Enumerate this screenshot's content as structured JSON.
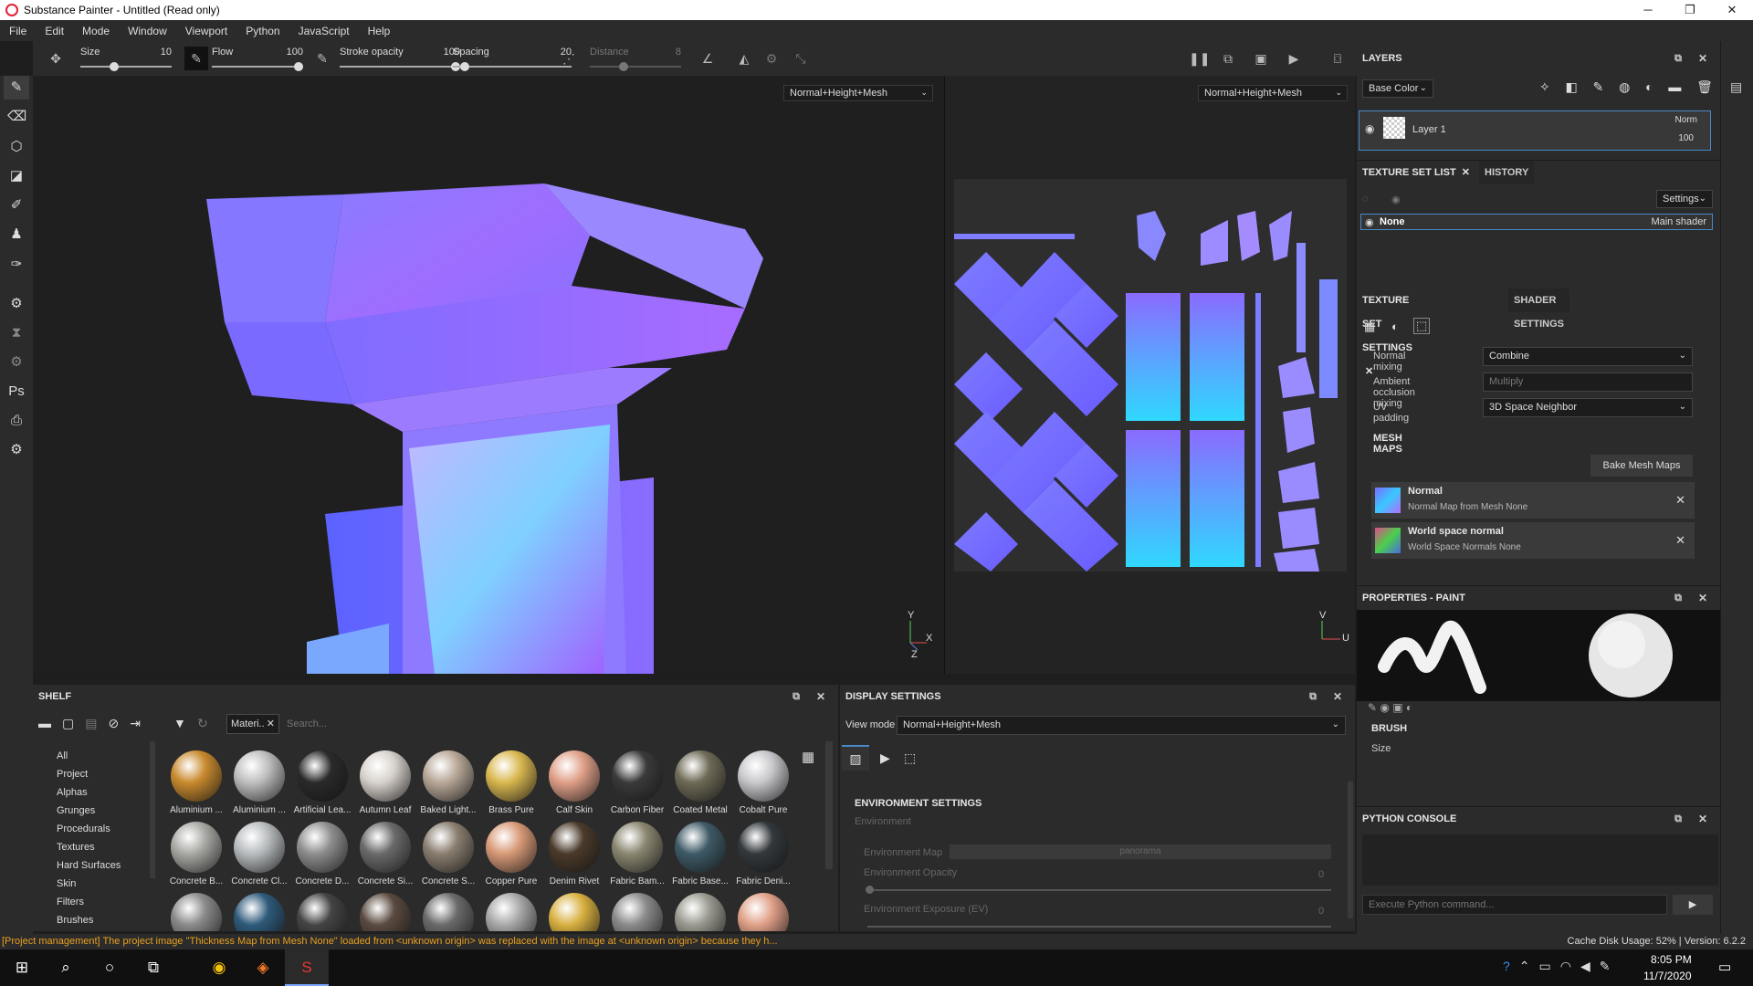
{
  "window": {
    "title": "Substance Painter - Untitled (Read only)",
    "minimize": "─",
    "restore": "❐",
    "close": "✕"
  },
  "menu": [
    "File",
    "Edit",
    "Mode",
    "Window",
    "Viewport",
    "Python",
    "JavaScript",
    "Help"
  ],
  "toolbar": {
    "size": {
      "label": "Size",
      "value": "10",
      "fraction": 0.35
    },
    "flow": {
      "label": "Flow",
      "value": "100",
      "fraction": 1.0
    },
    "stroke_opacity": {
      "label": "Stroke opacity",
      "value": "100",
      "fraction": 1.0
    },
    "spacing": {
      "label": "Spacing",
      "value": "20",
      "fraction": 0.1
    },
    "distance": {
      "label": "Distance",
      "value": "8",
      "fraction": 0.35
    }
  },
  "viewport3d": {
    "mode": "Normal+Height+Mesh",
    "axes": {
      "y": "Y",
      "x": "X",
      "z": "Z"
    }
  },
  "viewportuv": {
    "mode": "Normal+Height+Mesh",
    "axes": {
      "v": "V",
      "u": "U"
    }
  },
  "layers": {
    "title": "LAYERS",
    "channel": "Base Color",
    "layer": {
      "name": "Layer 1",
      "blend": "Norm",
      "opacity": "100"
    }
  },
  "texture_set_list": {
    "tabs": [
      "TEXTURE SET LIST",
      "HISTORY"
    ],
    "settings": "Settings",
    "item": {
      "name": "None",
      "shader": "Main shader"
    }
  },
  "texture_set_settings": {
    "tabs": [
      "TEXTURE SET SETTINGS",
      "SHADER SETTINGS"
    ],
    "normal_mixing": {
      "label": "Normal mixing",
      "value": "Combine"
    },
    "ao_mixing": {
      "label": "Ambient occlusion mixing",
      "value": "Multiply"
    },
    "uv_padding": {
      "label": "UV padding",
      "value": "3D Space Neighbor"
    },
    "mesh_maps_title": "MESH MAPS",
    "bake_button": "Bake Mesh Maps",
    "maps": [
      {
        "name": "Normal",
        "desc": "Normal Map from Mesh None"
      },
      {
        "name": "World space normal",
        "desc": "World Space Normals None"
      }
    ]
  },
  "properties": {
    "title": "PROPERTIES - PAINT",
    "brush_title": "BRUSH",
    "size_label": "Size"
  },
  "python_console": {
    "title": "PYTHON CONSOLE",
    "placeholder": "Execute Python command..."
  },
  "shelf": {
    "title": "SHELF",
    "filter_tag": "Materi..",
    "search_placeholder": "Search...",
    "categories": [
      "All",
      "Project",
      "Alphas",
      "Grunges",
      "Procedurals",
      "Textures",
      "Hard Surfaces",
      "Skin",
      "Filters",
      "Brushes"
    ],
    "materials_row1": [
      {
        "name": "Aluminium ...",
        "color": "#c98a2e"
      },
      {
        "name": "Aluminium ...",
        "color": "#bfbfbf"
      },
      {
        "name": "Artificial Lea...",
        "color": "#2a2a2a"
      },
      {
        "name": "Autumn Leaf",
        "color": "#d8d2cc"
      },
      {
        "name": "Baked Light...",
        "color": "#b8a898"
      },
      {
        "name": "Brass Pure",
        "color": "#d9b850"
      },
      {
        "name": "Calf Skin",
        "color": "#e0a088"
      },
      {
        "name": "Carbon Fiber",
        "color": "#3a3a3a"
      },
      {
        "name": "Coated Metal",
        "color": "#6e6a56"
      },
      {
        "name": "Cobalt Pure",
        "color": "#c8c8cc"
      }
    ],
    "materials_row2": [
      {
        "name": "Concrete B...",
        "color": "#a8a8a4"
      },
      {
        "name": "Concrete Cl...",
        "color": "#b8bcbe"
      },
      {
        "name": "Concrete D...",
        "color": "#8e8e8e"
      },
      {
        "name": "Concrete Si...",
        "color": "#6a6a6a"
      },
      {
        "name": "Concrete S...",
        "color": "#8a7e70"
      },
      {
        "name": "Copper Pure",
        "color": "#d89a78"
      },
      {
        "name": "Denim Rivet",
        "color": "#4a3a2a"
      },
      {
        "name": "Fabric Bam...",
        "color": "#8a8670"
      },
      {
        "name": "Fabric Base...",
        "color": "#3e5a66"
      },
      {
        "name": "Fabric Deni...",
        "color": "#33383c"
      }
    ],
    "materials_row3": [
      "#8a8a8a",
      "#2e5a7a",
      "#444444",
      "#5a4a40",
      "#6a6a6a",
      "#a8a8a8",
      "#d8b040",
      "#8a8a8a",
      "#9a9a90",
      "#e0a088"
    ]
  },
  "display_settings": {
    "title": "DISPLAY SETTINGS",
    "view_mode_label": "View mode",
    "view_mode": "Normal+Height+Mesh",
    "env_title": "ENVIRONMENT SETTINGS",
    "environment_label": "Environment",
    "env_map_label": "Environment Map",
    "env_map_value": "panorama",
    "env_opacity_label": "Environment Opacity",
    "env_opacity_value": "0",
    "env_exposure_label": "Environment Exposure (EV)",
    "env_exposure_value": "0"
  },
  "status": {
    "message": "[Project management] The project image \"Thickness Map from Mesh None\" loaded from <unknown origin> was replaced with the image at <unknown origin> because they h...",
    "cache": "Cache Disk Usage:   52% | Version: 6.2.2",
    "message_color": "#e8a020"
  },
  "taskbar": {
    "time": "8:05 PM",
    "date": "11/7/2020"
  }
}
